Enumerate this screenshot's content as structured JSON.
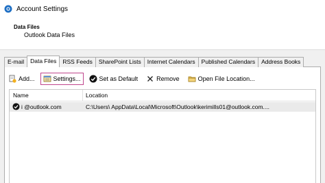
{
  "window": {
    "title": "Account Settings",
    "icon": "outlook-logo-icon"
  },
  "header": {
    "title": "Data Files",
    "subtitle": "Outlook Data Files"
  },
  "tabs": [
    {
      "label": "E-mail",
      "active": false
    },
    {
      "label": "Data Files",
      "active": true
    },
    {
      "label": "RSS Feeds",
      "active": false
    },
    {
      "label": "SharePoint Lists",
      "active": false
    },
    {
      "label": "Internet Calendars",
      "active": false
    },
    {
      "label": "Published Calendars",
      "active": false
    },
    {
      "label": "Address Books",
      "active": false
    }
  ],
  "toolbar": {
    "add_label": "Add...",
    "settings_label": "Settings...",
    "set_default_label": "Set as Default",
    "remove_label": "Remove",
    "open_location_label": "Open File Location..."
  },
  "table": {
    "columns": [
      "Name",
      "Location"
    ],
    "rows": [
      {
        "default": true,
        "name": "i              @outlook.com",
        "location": "C:\\Users\\           AppData\\Local\\Microsoft\\Outlook\\kerimills01@outlook.com...."
      }
    ]
  },
  "colors": {
    "highlight_border": "#c0448c",
    "panel_bg": "#f0f0f0",
    "selected_row": "#eaeaea"
  }
}
